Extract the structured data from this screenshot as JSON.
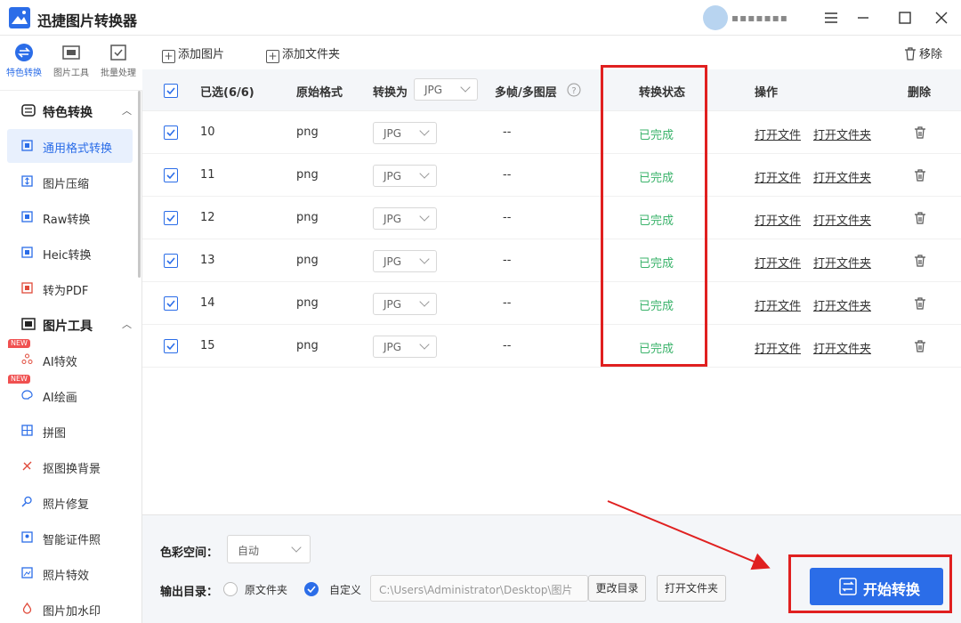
{
  "app": {
    "title": "迅捷图片转换器",
    "user_name": "▪▪▪▪▪▪▪"
  },
  "window_controls": {
    "menu_icon": "hamburger-icon",
    "minimize_icon": "minimize-icon",
    "maximize_icon": "maximize-icon",
    "close_icon": "close-icon"
  },
  "side_top": [
    {
      "label": "特色转换",
      "icon": "special-convert-icon",
      "active": true
    },
    {
      "label": "图片工具",
      "icon": "image-tools-icon",
      "active": false
    },
    {
      "label": "批量处理",
      "icon": "batch-icon",
      "active": false
    }
  ],
  "sidebar": {
    "group1": {
      "label": "特色转换",
      "icon": "special-convert-icon"
    },
    "group1_items": [
      {
        "label": "通用格式转换",
        "icon": "convert-icon",
        "active": true
      },
      {
        "label": "图片压缩",
        "icon": "compress-icon"
      },
      {
        "label": "Raw转换",
        "icon": "raw-icon"
      },
      {
        "label": "Heic转换",
        "icon": "heic-icon"
      },
      {
        "label": "转为PDF",
        "icon": "pdf-icon"
      }
    ],
    "group2": {
      "label": "图片工具",
      "icon": "image-tools-icon"
    },
    "group2_items": [
      {
        "label": "AI特效",
        "icon": "ai-effect-icon",
        "badge": "NEW"
      },
      {
        "label": "AI绘画",
        "icon": "ai-paint-icon",
        "badge": "NEW"
      },
      {
        "label": "拼图",
        "icon": "collage-icon"
      },
      {
        "label": "抠图换背景",
        "icon": "cutout-icon"
      },
      {
        "label": "照片修复",
        "icon": "repair-icon"
      },
      {
        "label": "智能证件照",
        "icon": "id-photo-icon"
      },
      {
        "label": "照片特效",
        "icon": "photo-effect-icon"
      },
      {
        "label": "图片加水印",
        "icon": "watermark-icon"
      }
    ]
  },
  "toolbar": {
    "add_image": "添加图片",
    "add_folder": "添加文件夹",
    "remove": "移除"
  },
  "table": {
    "headers": {
      "selected": "已选(6/6)",
      "orig_format": "原始格式",
      "convert_to": "转换为",
      "convert_to_value": "JPG",
      "multiframe": "多帧/多图层",
      "status": "转换状态",
      "actions": "操作",
      "delete": "删除"
    },
    "rows": [
      {
        "name": "10",
        "format": "png",
        "target": "JPG",
        "multiframe": "--",
        "status": "已完成",
        "open_file": "打开文件",
        "open_folder": "打开文件夹"
      },
      {
        "name": "11",
        "format": "png",
        "target": "JPG",
        "multiframe": "--",
        "status": "已完成",
        "open_file": "打开文件",
        "open_folder": "打开文件夹"
      },
      {
        "name": "12",
        "format": "png",
        "target": "JPG",
        "multiframe": "--",
        "status": "已完成",
        "open_file": "打开文件",
        "open_folder": "打开文件夹"
      },
      {
        "name": "13",
        "format": "png",
        "target": "JPG",
        "multiframe": "--",
        "status": "已完成",
        "open_file": "打开文件",
        "open_folder": "打开文件夹"
      },
      {
        "name": "14",
        "format": "png",
        "target": "JPG",
        "multiframe": "--",
        "status": "已完成",
        "open_file": "打开文件",
        "open_folder": "打开文件夹"
      },
      {
        "name": "15",
        "format": "png",
        "target": "JPG",
        "multiframe": "--",
        "status": "已完成",
        "open_file": "打开文件",
        "open_folder": "打开文件夹"
      }
    ]
  },
  "bottom": {
    "color_space_label": "色彩空间：",
    "color_space_value": "自动",
    "output_label": "输出目录：",
    "radio_original": "原文件夹",
    "radio_custom": "自定义",
    "output_path": "C:\\Users\\Administrator\\Desktop\\图片",
    "change_dir": "更改目录",
    "open_folder": "打开文件夹",
    "start": "开始转换"
  },
  "colors": {
    "accent": "#2b6de8",
    "success": "#3bb36b",
    "annotation_red": "#e02020"
  }
}
